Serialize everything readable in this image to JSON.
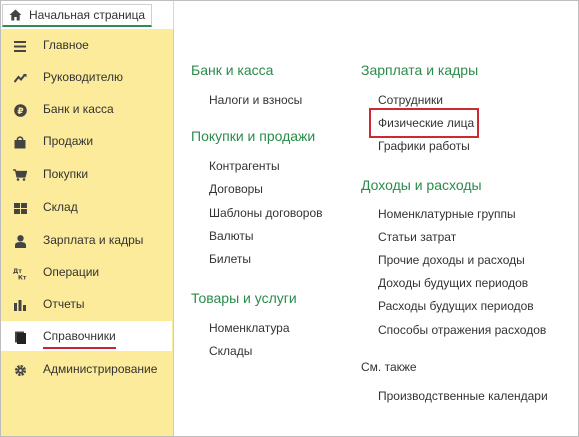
{
  "start_tab": {
    "label": "Начальная страница",
    "icon": "home-icon"
  },
  "sidebar": {
    "items": [
      {
        "label": "Главное",
        "icon": "menu-lines-icon"
      },
      {
        "label": "Руководителю",
        "icon": "trend-chart-icon"
      },
      {
        "label": "Банк и касса",
        "icon": "ruble-coin-icon"
      },
      {
        "label": "Продажи",
        "icon": "shopping-bag-icon"
      },
      {
        "label": "Покупки",
        "icon": "cart-icon"
      },
      {
        "label": "Склад",
        "icon": "warehouse-grid-icon"
      },
      {
        "label": "Зарплата и кадры",
        "icon": "person-icon"
      },
      {
        "label": "Операции",
        "icon": "dt-kt-icon"
      },
      {
        "label": "Отчеты",
        "icon": "bar-chart-icon"
      },
      {
        "label": "Справочники",
        "icon": "books-icon",
        "active": true
      },
      {
        "label": "Администрирование",
        "icon": "gear-icon"
      }
    ]
  },
  "main": {
    "left": {
      "bank": {
        "title": "Банк и касса",
        "links": [
          "Налоги и взносы"
        ]
      },
      "purchases_sales": {
        "title": "Покупки и продажи",
        "links": [
          "Контрагенты",
          "Договоры",
          "Шаблоны договоров",
          "Валюты",
          "Билеты"
        ]
      },
      "goods": {
        "title": "Товары и услуги",
        "links": [
          "Номенклатура",
          "Склады"
        ]
      }
    },
    "right": {
      "salary": {
        "title": "Зарплата и кадры",
        "links": [
          "Сотрудники",
          "Физические лица",
          "Графики работы"
        ]
      },
      "income_expenses": {
        "title": "Доходы и расходы",
        "links": [
          "Номенклатурные группы",
          "Статьи затрат",
          "Прочие доходы и расходы",
          "Доходы будущих периодов",
          "Расходы будущих периодов",
          "Способы отражения расходов"
        ]
      },
      "see_also": {
        "title": "См. также",
        "links": [
          "Производственные календари"
        ]
      }
    }
  },
  "colors": {
    "sidebar_bg": "#fbeb9b",
    "section_title": "#2a8c4a",
    "highlight": "#cc2a30",
    "active_underline": "#c8262c"
  }
}
